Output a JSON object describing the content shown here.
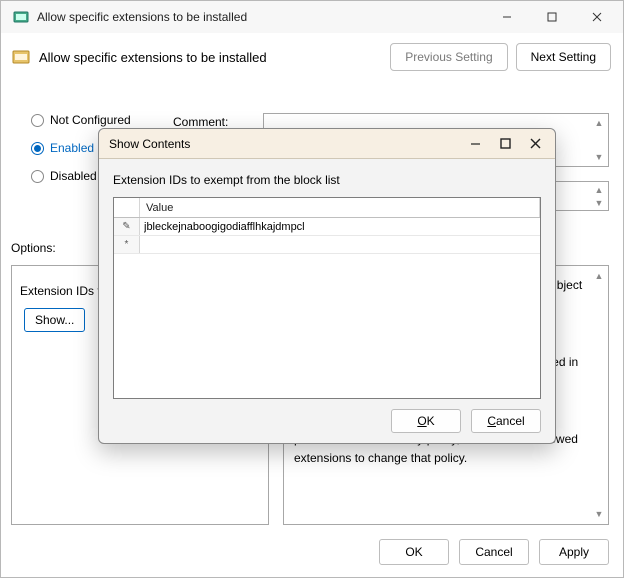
{
  "window": {
    "title": "Allow specific extensions to be installed",
    "controls": {
      "min": "–",
      "max": "▢",
      "close": "✕"
    }
  },
  "header": {
    "title": "Allow specific extensions to be installed",
    "previous": "Previous Setting",
    "next": "Next Setting"
  },
  "state": {
    "items": [
      {
        "label": "Not Configured",
        "checked": false
      },
      {
        "label": "Enabled",
        "checked": true
      },
      {
        "label": "Disabled",
        "checked": false
      }
    ]
  },
  "comment": {
    "label": "Comment:",
    "value": ""
  },
  "supported": {
    "value": ""
  },
  "options": {
    "label": "Options:",
    "extension_label": "Extension IDs to exempt from the block list",
    "show_label": "Show..."
  },
  "help": {
    "text": "Allows you to specify which extensions are not subject to the blocklist.\n\nA blocklist value of '*' means all extensions are blocked and users can only install extensions listed in the allow list.\n\nBy default, all extensions are allowed. But, if you prohibited extensions by policy, use the list of allowed extensions to change that policy."
  },
  "buttons": {
    "ok": "OK",
    "cancel": "Cancel",
    "apply": "Apply"
  },
  "dialog": {
    "title": "Show Contents",
    "caption": "Extension IDs to exempt from the block list",
    "columns": {
      "value": "Value"
    },
    "rows": [
      {
        "marker": "✎",
        "value": "jbleckejnaboogigodiafflhkajdmpcl"
      },
      {
        "marker": "*",
        "value": ""
      }
    ],
    "ok": "OK",
    "cancel": "Cancel"
  }
}
